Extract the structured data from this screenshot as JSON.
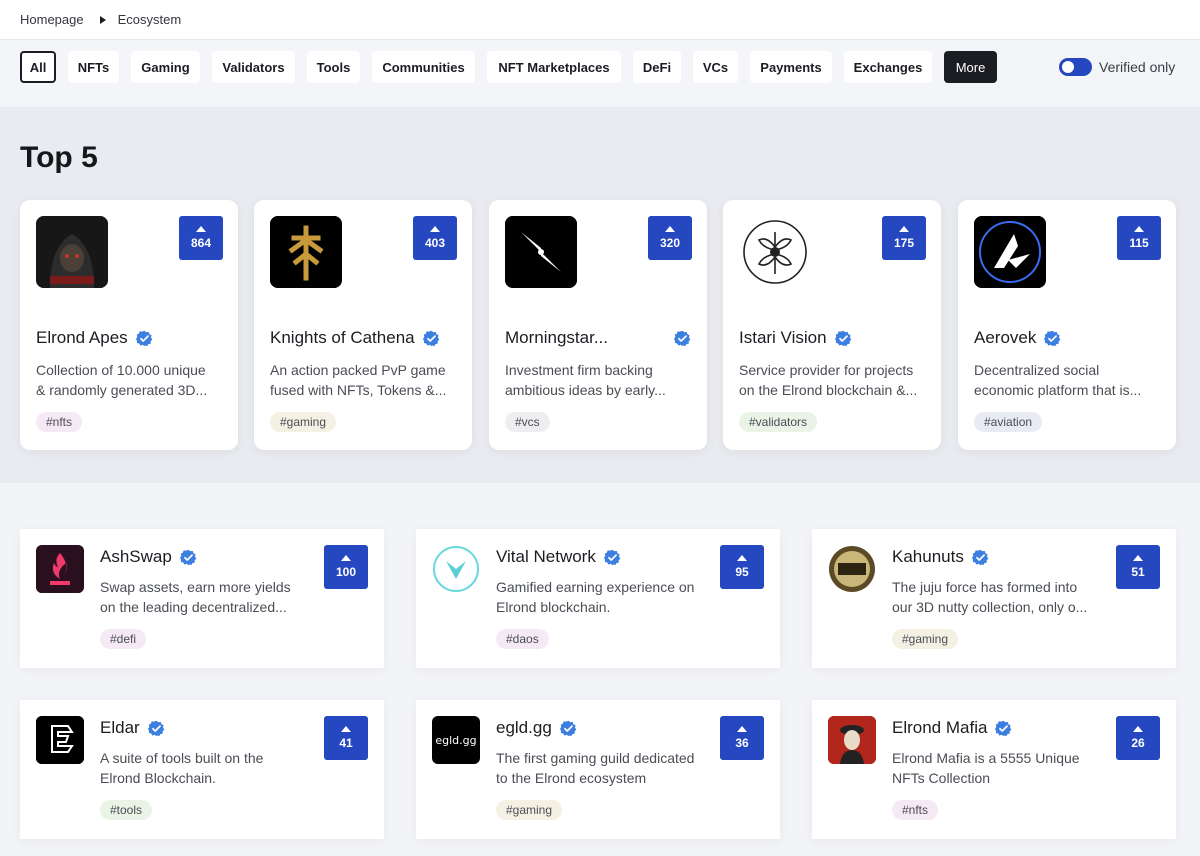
{
  "breadcrumb": {
    "home": "Homepage",
    "current": "Ecosystem"
  },
  "filters": [
    {
      "label": "All",
      "state": "active"
    },
    {
      "label": "NFTs",
      "state": "normal"
    },
    {
      "label": "Gaming",
      "state": "normal"
    },
    {
      "label": "Validators",
      "state": "normal"
    },
    {
      "label": "Tools",
      "state": "normal"
    },
    {
      "label": "Communities",
      "state": "normal"
    },
    {
      "label": "NFT Marketplaces",
      "state": "normal"
    },
    {
      "label": "DeFi",
      "state": "normal"
    },
    {
      "label": "VCs",
      "state": "normal"
    },
    {
      "label": "Payments",
      "state": "normal"
    },
    {
      "label": "Exchanges",
      "state": "normal"
    },
    {
      "label": "More",
      "state": "dark"
    }
  ],
  "verified_toggle": {
    "label": "Verified only",
    "on": true
  },
  "top5": {
    "title": "Top 5",
    "cards": [
      {
        "name": "Elrond Apes",
        "votes": "864",
        "desc1": "Collection of 10.000 unique",
        "desc2": "& randomly generated 3D...",
        "tag": "#nfts",
        "tag_color": "#f6e9f6",
        "logo": "ape-hood-logo",
        "verified": true
      },
      {
        "name": "Knights of Cathena",
        "votes": "403",
        "desc1": "An action packed PvP game",
        "desc2": "fused with NFTs, Tokens &...",
        "tag": "#gaming",
        "tag_color": "#f4f1e4",
        "logo": "cathena-rune-logo",
        "verified": true
      },
      {
        "name": "Morningstar...",
        "votes": "320",
        "desc1": "Investment firm backing",
        "desc2": "ambitious ideas by early...",
        "tag": "#vcs",
        "tag_color": "#eeeef1",
        "logo": "morningstar-star-logo",
        "verified": true
      },
      {
        "name": "Istari Vision",
        "votes": "175",
        "desc1": "Service provider for projects",
        "desc2": "on the Elrond blockchain &...",
        "tag": "#validators",
        "tag_color": "#e9f3e6",
        "logo": "istari-tree-logo",
        "verified": true
      },
      {
        "name": "Aerovek",
        "votes": "115",
        "desc1": "Decentralized social",
        "desc2": "economic platform that is...",
        "tag": "#aviation",
        "tag_color": "#e9ebf4",
        "logo": "aerovek-logo",
        "verified": true
      }
    ]
  },
  "list": [
    {
      "name": "AshSwap",
      "votes": "100",
      "desc1": "Swap assets, earn more yields",
      "desc2": "on the leading decentralized...",
      "tag": "#defi",
      "tag_color": "#f6e9f6",
      "logo": "ashswap-flame-logo",
      "verified": true
    },
    {
      "name": "Vital Network",
      "votes": "95",
      "desc1": "Gamified earning experience on",
      "desc2": "Elrond blockchain.",
      "tag": "#daos",
      "tag_color": "#f6e9f6",
      "logo": "vital-v-logo",
      "verified": true
    },
    {
      "name": "Kahunuts",
      "votes": "51",
      "desc1": "The juju force has formed into",
      "desc2": "our 3D nutty collection, only o...",
      "tag": "#gaming",
      "tag_color": "#f4f1e4",
      "logo": "kahunuts-badge-logo",
      "verified": true
    },
    {
      "name": "Eldar",
      "votes": "41",
      "desc1": "A suite of tools built on the",
      "desc2": "Elrond Blockchain.",
      "tag": "#tools",
      "tag_color": "#e9f3e6",
      "logo": "eldar-logo",
      "verified": true
    },
    {
      "name": "egld.gg",
      "votes": "36",
      "desc1": "The first gaming guild dedicated",
      "desc2": "to the Elrond ecosystem",
      "tag": "#gaming",
      "tag_color": "#f4f1e4",
      "logo": "egldgg-logo",
      "logo_text": "egld.gg",
      "verified": true
    },
    {
      "name": "Elrond Mafia",
      "votes": "26",
      "desc1": "Elrond Mafia is a 5555 Unique",
      "desc2": "NFTs Collection",
      "tag": "#nfts",
      "tag_color": "#f6e9f6",
      "logo": "mafia-portrait-logo",
      "verified": true
    }
  ],
  "colors": {
    "accent": "#2548c0",
    "verified": "#3d7fe0",
    "dark": "#1c1d22"
  }
}
